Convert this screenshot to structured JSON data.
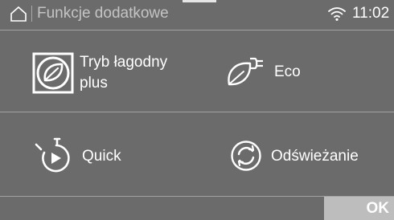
{
  "header": {
    "title": "Funkcje dodatkowe",
    "time": "11:02",
    "home_icon": "home-icon",
    "wifi_icon": "wifi-icon"
  },
  "options": [
    {
      "label_line1": "Tryb łagodny",
      "label_line2": "plus",
      "icon": "gentle-leaf-icon"
    },
    {
      "label": "Eco",
      "icon": "eco-leaf-plug-icon"
    },
    {
      "label": "Quick",
      "icon": "stopwatch-icon"
    },
    {
      "label": "Odświeżanie",
      "icon": "refresh-icon"
    }
  ],
  "footer": {
    "ok_label": "OK"
  },
  "colors": {
    "background": "#6b6b6b",
    "divider": "#a2a2a2",
    "ok_button": "#bdbdbd",
    "title_text": "#c4c4c4"
  }
}
